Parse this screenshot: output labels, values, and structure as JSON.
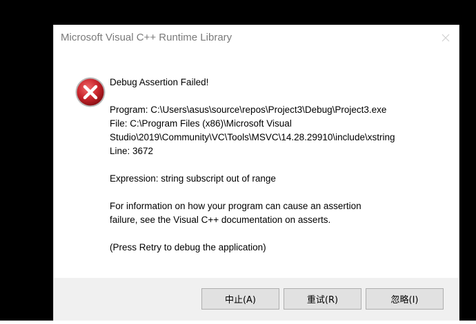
{
  "window": {
    "title": "Microsoft Visual C++ Runtime Library",
    "close_glyph": "✕"
  },
  "icon": "error-icon",
  "message": {
    "heading": "Debug Assertion Failed!",
    "program": "Program: C:\\Users\\asus\\source\\repos\\Project3\\Debug\\Project3.exe",
    "file_line1": "File: C:\\Program Files (x86)\\Microsoft Visual",
    "file_line2": "Studio\\2019\\Community\\VC\\Tools\\MSVC\\14.28.29910\\include\\xstring",
    "line": "Line: 3672",
    "expression": "Expression: string subscript out of range",
    "info_line1": "For information on how your program can cause an assertion",
    "info_line2": "failure, see the Visual C++ documentation on asserts.",
    "retry_hint": "(Press Retry to debug the application)"
  },
  "buttons": {
    "abort": "中止(A)",
    "retry": "重试(R)",
    "ignore": "忽略(I)"
  },
  "colors": {
    "icon_red": "#c9252c",
    "title_gray": "#7a7a7a",
    "footer_bg": "#f0f0f0"
  }
}
